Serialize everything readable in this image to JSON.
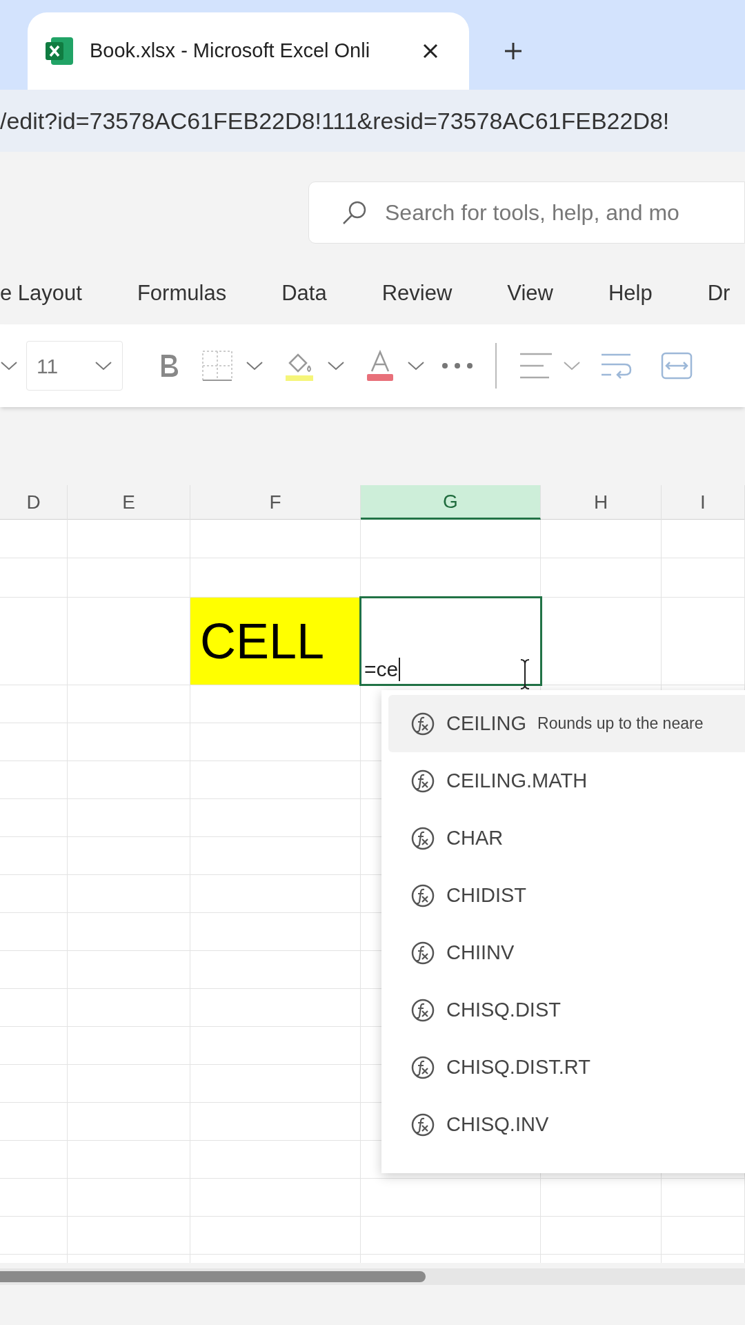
{
  "browser_tab": {
    "title": "Book.xlsx - Microsoft Excel Onli"
  },
  "address_bar": {
    "url": "/edit?id=73578AC61FEB22D8!111&resid=73578AC61FEB22D8!"
  },
  "search": {
    "placeholder": "Search for tools, help, and mo"
  },
  "ribbon_tabs": [
    "e Layout",
    "Formulas",
    "Data",
    "Review",
    "View",
    "Help",
    "Dr"
  ],
  "toolbar": {
    "font_size": "11"
  },
  "columns": [
    {
      "label": "D",
      "selected": false
    },
    {
      "label": "E",
      "selected": false
    },
    {
      "label": "F",
      "selected": false
    },
    {
      "label": "G",
      "selected": true
    },
    {
      "label": "H",
      "selected": false
    },
    {
      "label": "I",
      "selected": false
    }
  ],
  "cells": [
    {
      "kind": "highlighted",
      "text": "CELL"
    },
    {
      "kind": "editing",
      "text": "=ce"
    }
  ],
  "autocomplete": [
    {
      "name": "CEILING",
      "description": "Rounds up to the neare",
      "selected": true
    },
    {
      "name": "CEILING.MATH",
      "selected": false
    },
    {
      "name": "CHAR",
      "selected": false
    },
    {
      "name": "CHIDIST",
      "selected": false
    },
    {
      "name": "CHIINV",
      "selected": false
    },
    {
      "name": "CHISQ.DIST",
      "selected": false
    },
    {
      "name": "CHISQ.DIST.RT",
      "selected": false
    },
    {
      "name": "CHISQ.INV",
      "selected": false
    }
  ]
}
